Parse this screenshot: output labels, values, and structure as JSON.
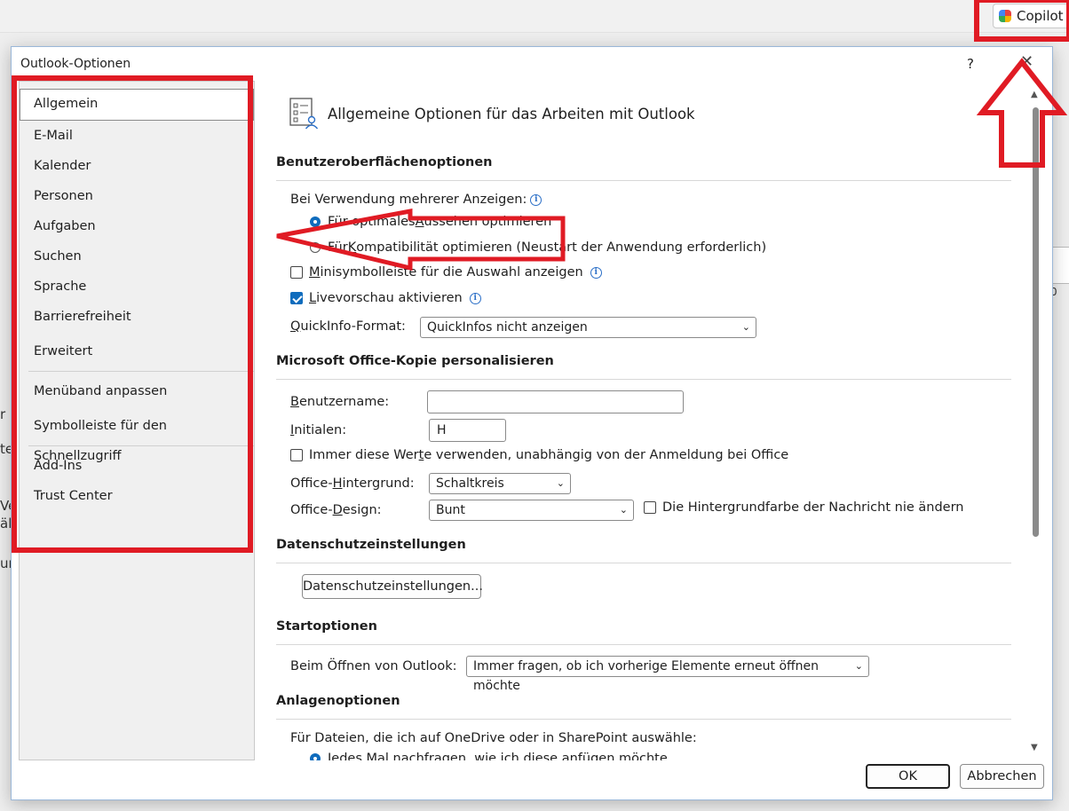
{
  "background": {
    "copilot_label": "Copilot",
    "left_fragments": [
      "r",
      "te",
      "Ve",
      "äl",
      "ur"
    ],
    "right_fragment": "0"
  },
  "dialog": {
    "title": "Outlook-Optionen",
    "help": "?",
    "close": "✕"
  },
  "nav": {
    "items": [
      "Allgemein",
      "E-Mail",
      "Kalender",
      "Personen",
      "Aufgaben",
      "Suchen",
      "Sprache",
      "Barrierefreiheit",
      "Erweitert",
      "Menüband anpassen",
      "Symbolleiste für den Schnellzugriff",
      "Add-Ins",
      "Trust Center"
    ],
    "selected": "Allgemein"
  },
  "content": {
    "header_title": "Allgemeine Optionen für das Arbeiten mit Outlook",
    "ui_section": {
      "title": "Benutzeroberflächenoptionen",
      "multi_display_label": "Bei Verwendung mehrerer Anzeigen:",
      "radio_optimal_pre": "Für optimales ",
      "radio_optimal_u": "A",
      "radio_optimal_post": "ussehen optimieren",
      "radio_compat_pre": "Für ",
      "radio_compat_u": "K",
      "radio_compat_post": "ompatibilität optimieren (Neustart der Anwendung erforderlich)",
      "mini_toolbar_u": "M",
      "mini_toolbar_post": "inisymbolleiste für die Auswahl anzeigen",
      "live_preview_u": "L",
      "live_preview_post": "ivevorschau aktivieren",
      "quickinfo_label_pre": "",
      "quickinfo_label_u": "Q",
      "quickinfo_label_post": "uickInfo-Format:",
      "quickinfo_value": "QuickInfos nicht anzeigen"
    },
    "personalize_section": {
      "title": "Microsoft Office-Kopie personalisieren",
      "username_u": "B",
      "username_post": "enutzername:",
      "username_value": "",
      "initials_u": "I",
      "initials_post": "nitialen:",
      "initials_value": "H",
      "always_use_pre": "Immer diese Wer",
      "always_use_u": "t",
      "always_use_post": "e verwenden, unabhängig von der Anmeldung bei Office",
      "background_pre": "Office-",
      "background_u": "H",
      "background_post": "intergrund:",
      "background_value": "Schaltkreis",
      "design_pre": "Office-",
      "design_u": "D",
      "design_post": "esign:",
      "design_value": "Bunt",
      "never_change_bg": "Die Hintergrundfarbe der Nachricht nie ändern"
    },
    "privacy_section": {
      "title": "Datenschutzeinstellungen",
      "button": "Datenschutzeinstellungen..."
    },
    "start_section": {
      "title": "Startoptionen",
      "open_label": "Beim Öffnen von Outlook:",
      "open_value": "Immer fragen, ob ich vorherige Elemente erneut öffnen möchte"
    },
    "attach_section": {
      "title": "Anlagenoptionen",
      "files_label": "Für Dateien, die ich auf OneDrive oder in SharePoint auswähle:",
      "ask_each_time": "Jedes Mal nachfragen, wie ich diese anfügen möchte"
    }
  },
  "footer": {
    "ok": "OK",
    "cancel": "Abbrechen"
  },
  "colors": {
    "accent": "#0f6cbd",
    "annotation_red": "#e01b24"
  },
  "icons": [
    "settings-list-icon",
    "info-icon",
    "chevron-down-icon",
    "copilot-logo-icon",
    "annotation-arrow-left",
    "annotation-arrow-up"
  ]
}
